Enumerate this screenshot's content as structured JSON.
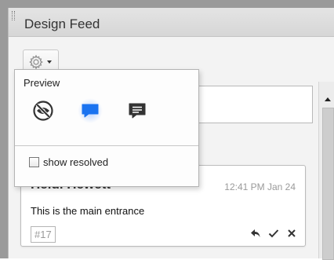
{
  "panel": {
    "title": "Design Feed"
  },
  "settings_menu": {
    "gear_icon": "gear-icon",
    "caret_icon": "chevron-down-icon",
    "preview_label": "Preview",
    "preview_modes": [
      {
        "icon": "eye-off-icon",
        "active": false
      },
      {
        "icon": "comment-bubble-icon",
        "active": true
      },
      {
        "icon": "comment-detail-icon",
        "active": false
      }
    ],
    "show_resolved_label": "show resolved",
    "show_resolved_checked": false,
    "accent": "#1a73f0"
  },
  "comment": {
    "author": "Heidi Hewett",
    "time": "12:41 PM Jan 24",
    "text": "This is the main entrance",
    "tag": "#17",
    "action_icons": [
      "reply-icon",
      "check-icon",
      "close-icon"
    ]
  }
}
